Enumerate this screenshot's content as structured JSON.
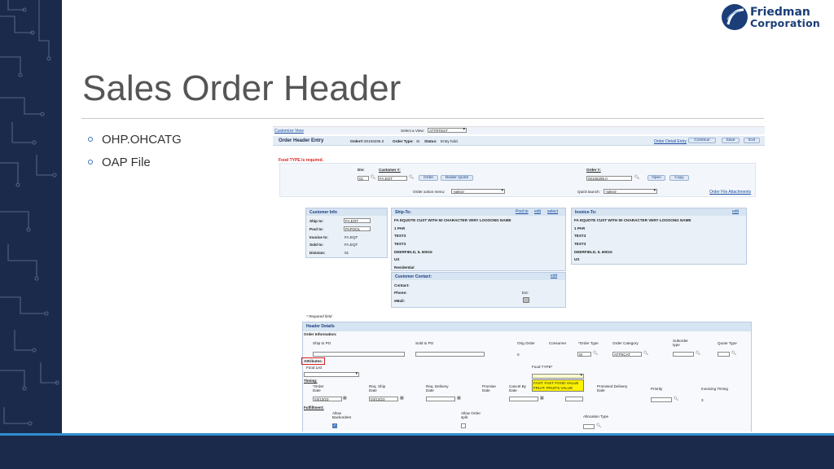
{
  "slide": {
    "title": "Sales Order Header",
    "bullets": [
      "OHP.OHCATG",
      "OAP File"
    ],
    "logo": {
      "line1": "Friedman",
      "line2": "Corporation"
    }
  },
  "colors": {
    "navy": "#1b2a4a",
    "accent": "#2f8fd1",
    "title": "#555555",
    "link": "#1a4fa3",
    "panel": "#e9f0f8",
    "highlight": "#d62020",
    "dropdown": "#fff200"
  },
  "screen": {
    "top": {
      "customize": "Customize View",
      "select_view_label": "Select a View:",
      "select_view_value": "ATTRTEST"
    },
    "header": {
      "title": "Order Header Entry",
      "order_label": "Order#:",
      "order_value": "00106295.0",
      "type_label": "Order Type:",
      "type_value": "SI",
      "status_label": "Status:",
      "status_value": "Entry hold",
      "order_detail": "Order Detail Entry",
      "continue": "Continue",
      "save": "Save",
      "exit": "Exit"
    },
    "error": "Food TYPE is required.",
    "search": {
      "div_label": "Div:",
      "div_value": "01",
      "customer_label": "Customer #:",
      "customer_value": "FA.EQT",
      "order_btn": "Order",
      "dealer_quote_btn": "Dealer Quote",
      "order_num_label": "Order #:",
      "order_num_value": "00106295.0",
      "open_btn": "Open",
      "copy_btn": "Copy",
      "action_menu_label": "Order action menu:",
      "action_menu_value": "-select-",
      "quick_launch_label": "Quick launch:",
      "quick_launch_value": "-select-",
      "file_attachments": "Order File Attachments"
    },
    "customer_info": {
      "title": "Customer Info",
      "rows": [
        {
          "label": "Ship to:",
          "value": "FA.EQT"
        },
        {
          "label": "Pool to:",
          "value": "PAPOOL"
        },
        {
          "label": "Invoice to:",
          "value": "FA.EQT"
        },
        {
          "label": "Sold to:",
          "value": "FA.EQT"
        },
        {
          "label": "Division:",
          "value": "01"
        }
      ]
    },
    "ship_to": {
      "title": "Ship-To:",
      "links": [
        "Pool to",
        "edit",
        "select"
      ],
      "lines": [
        "FA EQUOTE CUST WITH 50 CHARACTER VERY LOOOONG NAME",
        "1 PAR",
        "TEST3",
        "TEST3",
        "DEERFIELD, IL 60015",
        "US",
        "Residential"
      ]
    },
    "customer_contact": {
      "title": "Customer Contact:",
      "edit": "edit",
      "contact": "Contact:",
      "phone": "Phone:",
      "ext": "Ext:",
      "email": "eMail:"
    },
    "invoice_to": {
      "title": "Invoice-To:",
      "edit": "edit",
      "lines": [
        "FA EQUOTE CUST WITH 50 CHARACTER VERY LOOOONG NAME",
        "1 PAR",
        "TEST3",
        "TEST3",
        "DEERFIELD, IL 60015",
        "US"
      ]
    },
    "required_note": "* Required field",
    "header_details": {
      "title": "Header Details",
      "order_info": "Order Information:",
      "ship_to_po": "Ship to PO",
      "sold_to_po": "Sold to PO",
      "orig_order": "Orig Order",
      "orig_order_value": "0",
      "consumer": "Consumer",
      "order_type": "*Order Type",
      "order_type_value": "SI",
      "order_category": "Order Category",
      "order_category_value": "ATTRCAT",
      "suborder_type": "Suborder type",
      "quote_type": "Quote Type",
      "attributes": "Attributes:",
      "food_list": "Food List",
      "food_type": "Food TYPE*",
      "food_options": [
        "FAST: FAST FOOD VALUE",
        "FRUIT: FRUITS VALUE"
      ],
      "timing": "Timing:",
      "order_date": "*Order Date",
      "order_date_value": "03/13/23",
      "req_ship_date": "Req. Ship Date",
      "req_ship_value": "03/13/23",
      "req_delivery_date": "Req. Delivery Date",
      "promise_date": "Promise Date",
      "cancel_by_date": "Cancel By Date",
      "promised_delivery": "Promised Delivery Date",
      "priority": "Priority",
      "invoicing_timing": "Invoicing Timing",
      "invoicing_value": "3",
      "fulfillment": "Fulfillment:",
      "allow_backorders": "Allow Backorders",
      "allow_order_split": "Allow Order split",
      "allocation_type": "Allocation Type"
    }
  }
}
